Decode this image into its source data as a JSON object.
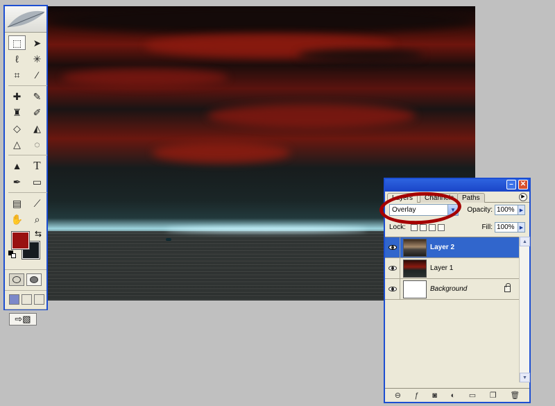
{
  "layers_panel": {
    "tabs": [
      "Layers",
      "Channels",
      "Paths"
    ],
    "blend_mode": "Overlay",
    "opacity_label": "Opacity:",
    "opacity_value": "100%",
    "lock_label": "Lock:",
    "fill_label": "Fill:",
    "fill_value": "100%",
    "layers": [
      {
        "name": "Layer 2",
        "selected": true
      },
      {
        "name": "Layer 1",
        "selected": false
      },
      {
        "name": "Background",
        "selected": false,
        "locked": true
      }
    ]
  },
  "toolbox": {
    "foreground_color": "#991111",
    "background_color": "#161b20",
    "tool_icons": [
      "marquee-tool-icon",
      "move-tool-icon",
      "lasso-tool-icon",
      "magic-wand-icon",
      "crop-tool-icon",
      "slice-tool-icon",
      "healing-brush-icon",
      "brush-tool-icon",
      "clone-stamp-icon",
      "history-brush-icon",
      "eraser-icon",
      "paint-bucket-icon",
      "blur-tool-icon",
      "dodge-tool-icon",
      "path-selection-icon",
      "type-tool-icon",
      "pen-tool-icon",
      "shape-tool-icon",
      "notes-tool-icon",
      "eyedropper-icon",
      "hand-tool-icon",
      "zoom-tool-icon"
    ]
  },
  "colors": {
    "window_border": "#1c4ed2",
    "selection": "#3166cc",
    "annotation": "#a50000"
  }
}
